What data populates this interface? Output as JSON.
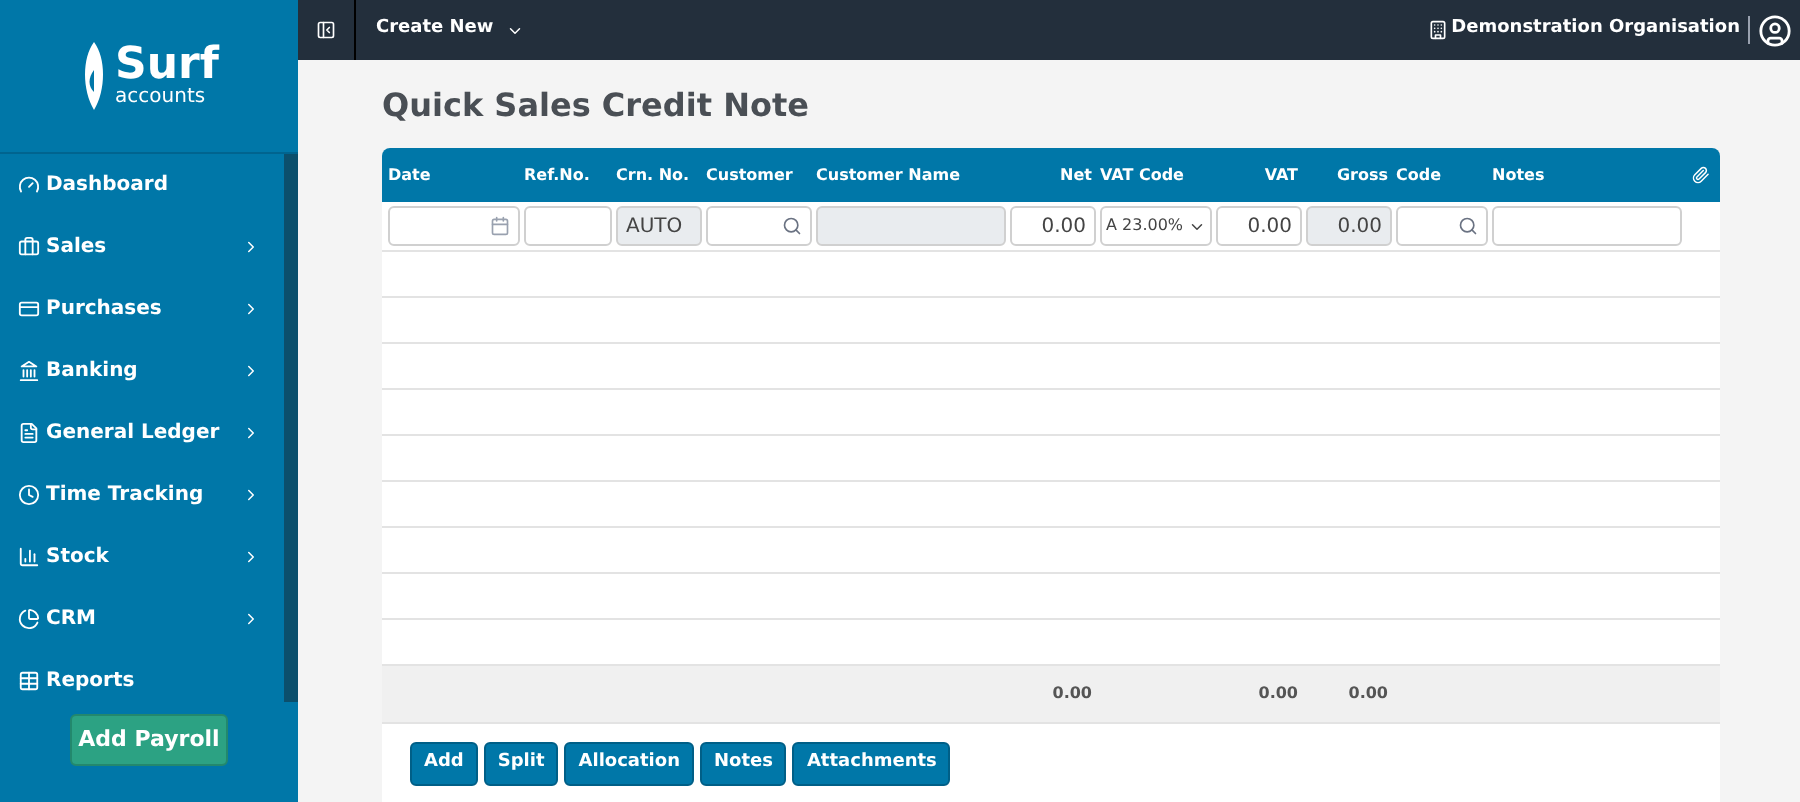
{
  "logo": {
    "name": "Surf",
    "subtitle": "accounts"
  },
  "sidebar": {
    "items": [
      {
        "label": "Dashboard",
        "has_submenu": false
      },
      {
        "label": "Sales",
        "has_submenu": true
      },
      {
        "label": "Purchases",
        "has_submenu": true
      },
      {
        "label": "Banking",
        "has_submenu": true
      },
      {
        "label": "General Ledger",
        "has_submenu": true
      },
      {
        "label": "Time Tracking",
        "has_submenu": true
      },
      {
        "label": "Stock",
        "has_submenu": true
      },
      {
        "label": "CRM",
        "has_submenu": true
      },
      {
        "label": "Reports",
        "has_submenu": false
      }
    ],
    "action": "Add Payroll"
  },
  "topbar": {
    "menu": "Create New",
    "organisation": "Demonstration Organisation"
  },
  "page_title": "Quick Sales Credit Note",
  "table": {
    "columns": [
      {
        "label": "Date"
      },
      {
        "label": "Ref.No."
      },
      {
        "label": "Crn. No."
      },
      {
        "label": "Customer"
      },
      {
        "label": "Customer Name"
      },
      {
        "label": "Net"
      },
      {
        "label": "VAT Code"
      },
      {
        "label": "VAT"
      },
      {
        "label": "Gross"
      },
      {
        "label": "Code"
      },
      {
        "label": "Notes"
      }
    ],
    "input_row": [
      {
        "kind": "date"
      },
      {
        "kind": "text"
      },
      {
        "kind": "readonly",
        "value": "AUTO"
      },
      {
        "kind": "search"
      },
      {
        "kind": "readonly"
      },
      {
        "kind": "number",
        "value": "0.00"
      },
      {
        "kind": "select",
        "value": "A 23.00%"
      },
      {
        "kind": "number",
        "value": "0.00"
      },
      {
        "kind": "readonly_number",
        "value": "0.00"
      },
      {
        "kind": "search"
      },
      {
        "kind": "text"
      }
    ],
    "totals": {
      "net": "0.00",
      "vat": "0.00",
      "gross": "0.00"
    }
  },
  "buttons": [
    "Add",
    "Split",
    "Allocation",
    "Notes",
    "Attachments"
  ]
}
